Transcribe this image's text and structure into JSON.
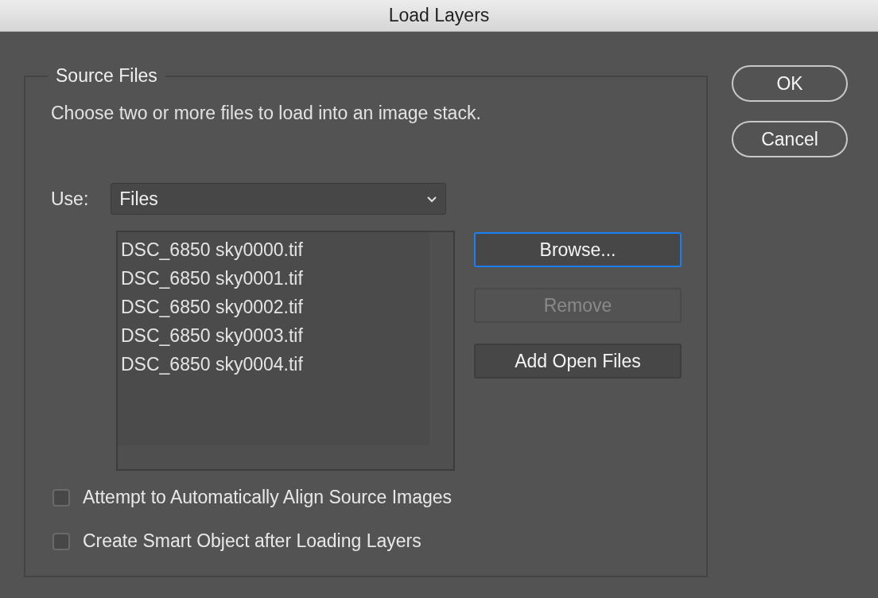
{
  "window": {
    "title": "Load Layers"
  },
  "source_files": {
    "legend": "Source Files",
    "description": "Choose two or more files to load into an image stack.",
    "use_label": "Use:",
    "use_value": "Files",
    "files": [
      "DSC_6850 sky0000.tif",
      "DSC_6850 sky0001.tif",
      "DSC_6850 sky0002.tif",
      "DSC_6850 sky0003.tif",
      "DSC_6850 sky0004.tif"
    ],
    "list_buttons": [
      {
        "label": "Browse...",
        "focused": true,
        "disabled": false
      },
      {
        "label": "Remove",
        "focused": false,
        "disabled": true
      },
      {
        "label": "Add Open Files",
        "focused": false,
        "disabled": false
      }
    ],
    "options": [
      {
        "label": "Attempt to Automatically Align Source Images",
        "checked": false
      },
      {
        "label": "Create Smart Object after Loading Layers",
        "checked": false
      }
    ]
  },
  "buttons": [
    "OK",
    "Cancel"
  ]
}
